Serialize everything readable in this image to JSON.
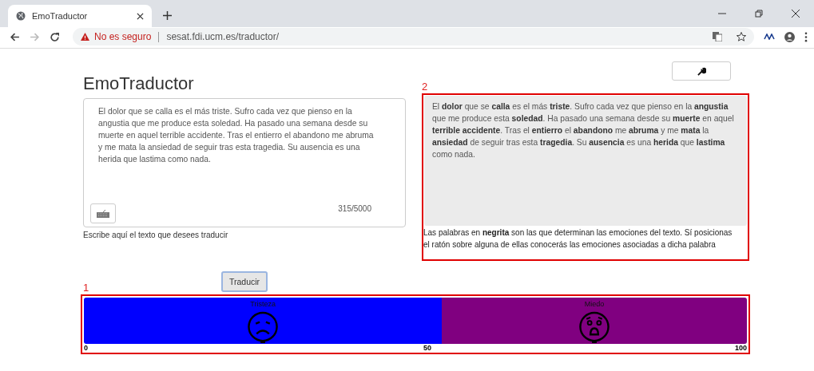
{
  "browser": {
    "tab_title": "EmoTraductor",
    "security": "No es seguro",
    "url": "sesat.fdi.ucm.es/traductor/"
  },
  "app": {
    "title": "EmoTraductor",
    "input": {
      "value": "El dolor que se calla es el más triste. Sufro cada vez que pienso en la angustia que me produce esta soledad. Ha pasado una semana desde su muerte en aquel terrible accidente. Tras el entierro el abandono me abruma y me mata la ansiedad de seguir tras esta tragedia. Su ausencia es una herida que lastima como nada.",
      "counter": "315/5000",
      "hint": "Escribe aquí el texto que desees traducir"
    },
    "translate_button": "Traducir",
    "output": {
      "annotation": "2",
      "text": "El **dolor** que se **calla** es el más **triste**. Sufro cada vez que pienso en la **angustia** que me produce esta **soledad**. Ha pasado una semana desde su **muerte** en aquel **terrible accidente**. Tras el **entierro** el **abandono** me **abruma** y me **mata** la **ansiedad** de seguir tras esta **tragedia**. Su **ausencia** es una **herida** que **lastima** como nada.",
      "note": "Las palabras en **negrita** son las que determinan las emociones del texto. Sí posicionas el ratón sobre alguna de ellas conocerás las emociones asociadas a dicha palabra"
    },
    "emotions": {
      "annotation": "1",
      "segments": [
        {
          "label": "Tristeza",
          "level": 0.54,
          "color": "#0000ff",
          "kind": "sad"
        },
        {
          "label": "Miedo",
          "level": 0.46,
          "color": "#800080",
          "kind": "scared"
        }
      ],
      "scale": [
        "0",
        "50",
        "100"
      ]
    }
  }
}
